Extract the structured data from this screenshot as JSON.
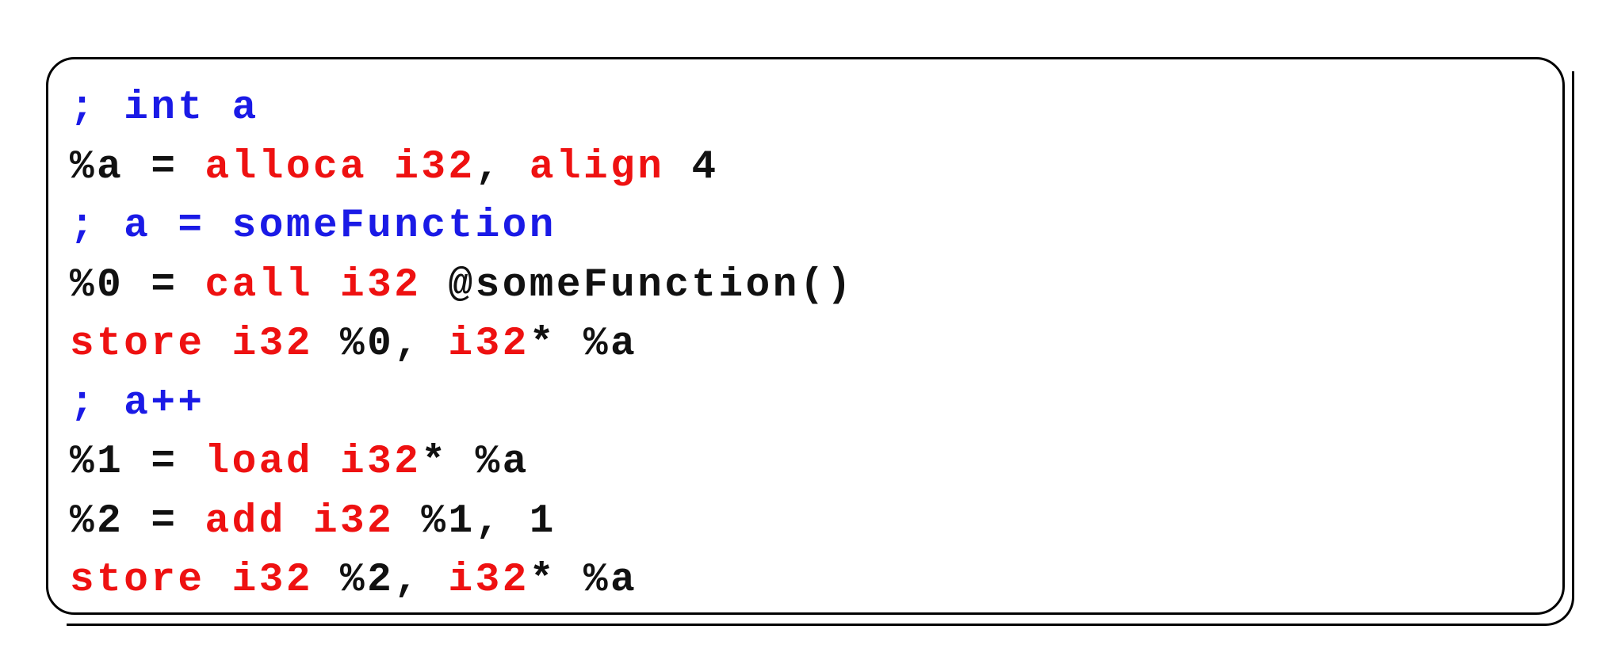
{
  "code_lines": [
    [
      {
        "text": "; int a",
        "kind": "comment"
      }
    ],
    [
      {
        "text": "%a = ",
        "kind": "plain"
      },
      {
        "text": "alloca i32",
        "kind": "kw"
      },
      {
        "text": ", ",
        "kind": "plain"
      },
      {
        "text": "align",
        "kind": "kw"
      },
      {
        "text": " 4",
        "kind": "plain"
      }
    ],
    [
      {
        "text": "; a = someFunction",
        "kind": "comment"
      }
    ],
    [
      {
        "text": "%0 = ",
        "kind": "plain"
      },
      {
        "text": "call i32",
        "kind": "kw"
      },
      {
        "text": " @someFunction()",
        "kind": "plain"
      }
    ],
    [
      {
        "text": "store i32",
        "kind": "kw"
      },
      {
        "text": " %0, ",
        "kind": "plain"
      },
      {
        "text": "i32",
        "kind": "kw"
      },
      {
        "text": "* %a",
        "kind": "plain"
      }
    ],
    [
      {
        "text": "; a++",
        "kind": "comment"
      }
    ],
    [
      {
        "text": "%1 = ",
        "kind": "plain"
      },
      {
        "text": "load i32",
        "kind": "kw"
      },
      {
        "text": "* %a",
        "kind": "plain"
      }
    ],
    [
      {
        "text": "%2 = ",
        "kind": "plain"
      },
      {
        "text": "add i32",
        "kind": "kw"
      },
      {
        "text": " %1, 1",
        "kind": "plain"
      }
    ],
    [
      {
        "text": "store i32",
        "kind": "kw"
      },
      {
        "text": " %2, ",
        "kind": "plain"
      },
      {
        "text": "i32",
        "kind": "kw"
      },
      {
        "text": "* %a",
        "kind": "plain"
      }
    ]
  ],
  "colors": {
    "keyword": "#ee1111",
    "comment": "#1a1ae6",
    "text": "#111111",
    "border": "#000000",
    "background": "#ffffff"
  }
}
